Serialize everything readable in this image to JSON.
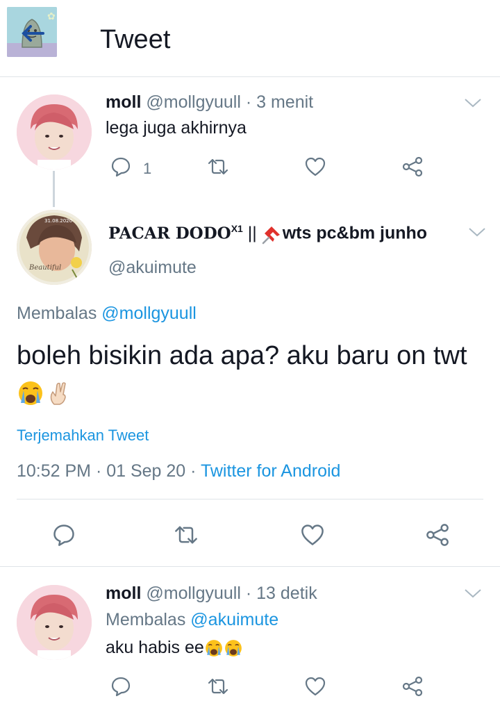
{
  "header": {
    "title": "Tweet"
  },
  "tweets": [
    {
      "name": "moll",
      "handle": "@mollgyuull",
      "time": "· 3 menit",
      "text": "lega juga akhirnya",
      "reply_count": "1"
    },
    {
      "name": "PACAR DODO",
      "name_sup": "X1",
      "name_sep": "||",
      "name_tail": "wts pc&bm junho",
      "handle": "@akuimute",
      "reply_prefix": "Membalas",
      "reply_to": "@mollgyuull",
      "text": "boleh bisikin ada apa? aku baru on twt",
      "translate": "Terjemahkan Tweet",
      "timestamp": "10:52 PM · 01 Sep 20 ·",
      "source": "Twitter for Android"
    },
    {
      "name": "moll",
      "handle": "@mollgyuull",
      "time": "· 13 detik",
      "reply_prefix": "Membalas",
      "reply_to": "@akuimute",
      "text": "aku habis ee"
    }
  ],
  "icons": [
    "back-arrow-icon",
    "chevron-down-icon",
    "reply-icon",
    "retweet-icon",
    "like-icon",
    "share-icon",
    "pushpin-icon",
    "crying-emoji-icon",
    "crossed-fingers-emoji-icon"
  ],
  "colors": {
    "link": "#1b95e0",
    "muted": "#657786",
    "text": "#141823",
    "divider": "#dfe4e8"
  }
}
